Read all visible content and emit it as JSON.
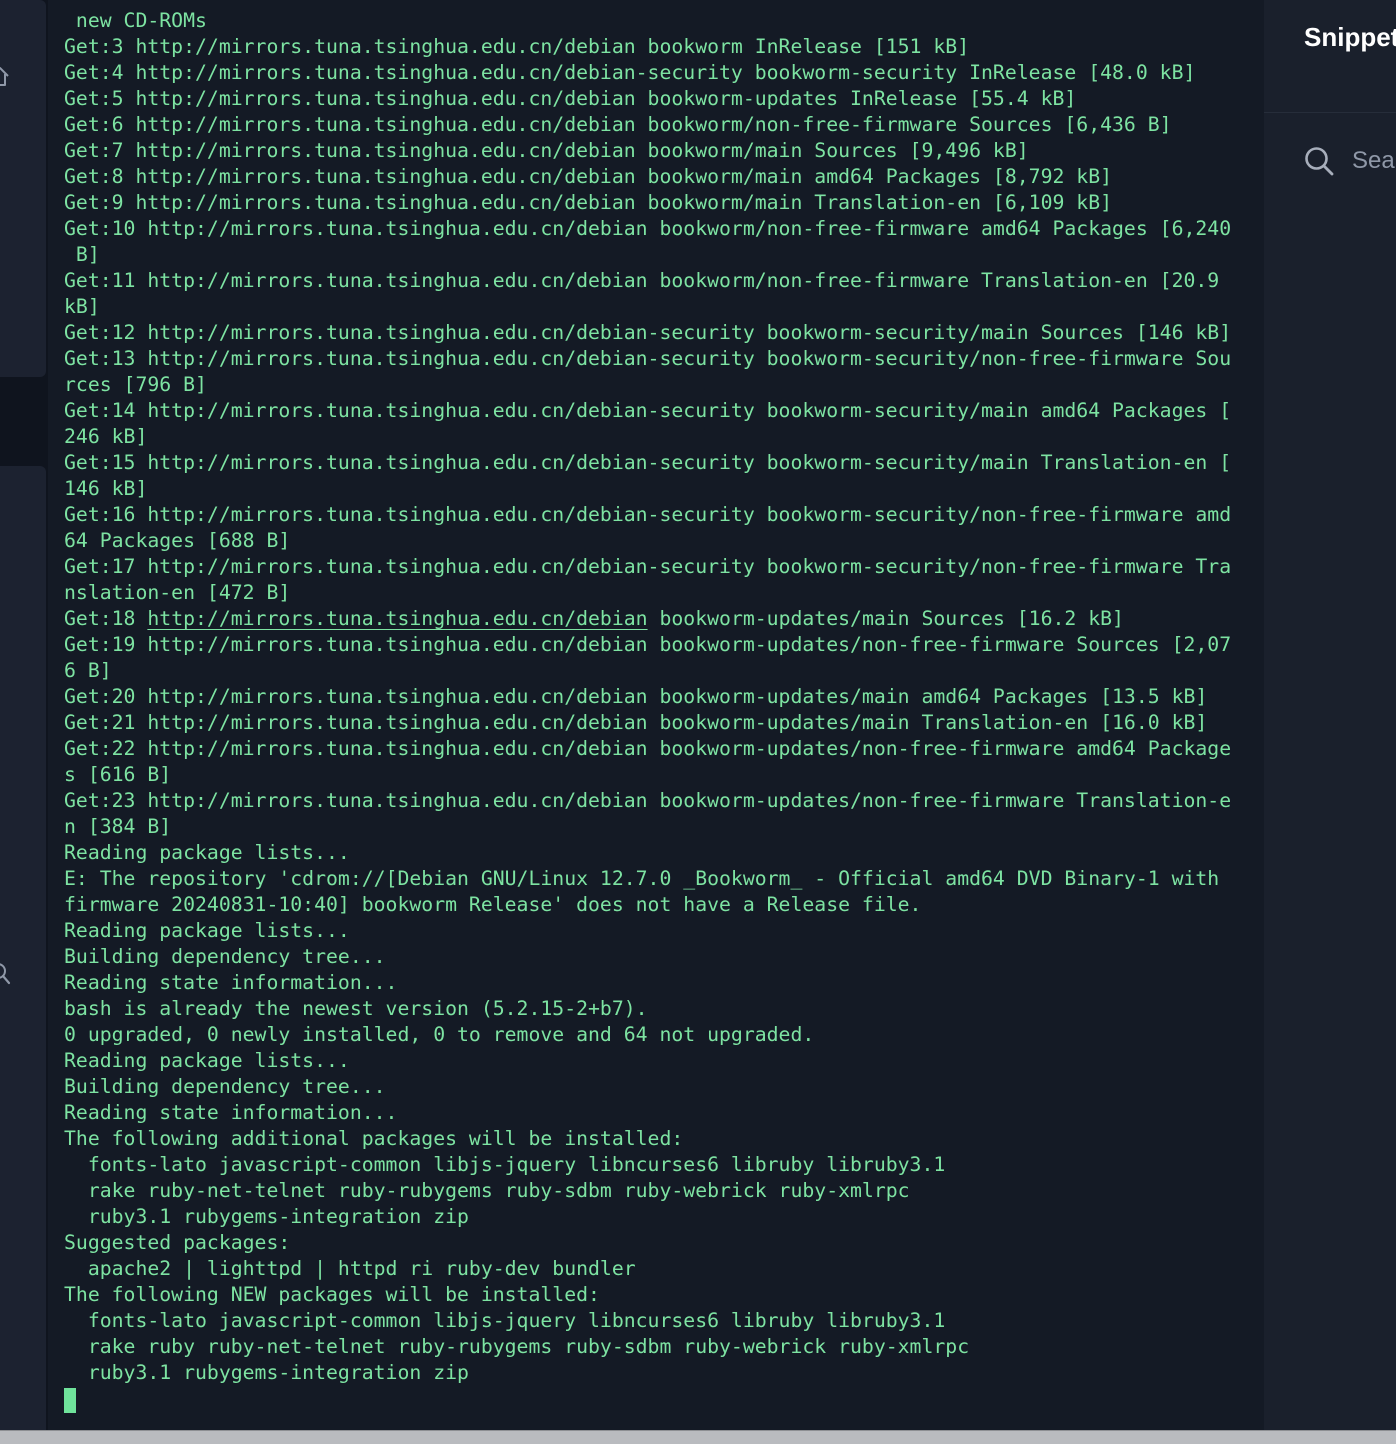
{
  "snippets": {
    "title": "Snippets",
    "search_placeholder": "Search"
  },
  "terminal": {
    "lines": [
      " new CD-ROMs",
      "Get:3 http://mirrors.tuna.tsinghua.edu.cn/debian bookworm InRelease [151 kB]",
      "Get:4 http://mirrors.tuna.tsinghua.edu.cn/debian-security bookworm-security InRelease [48.0 kB]",
      "Get:5 http://mirrors.tuna.tsinghua.edu.cn/debian bookworm-updates InRelease [55.4 kB]",
      "Get:6 http://mirrors.tuna.tsinghua.edu.cn/debian bookworm/non-free-firmware Sources [6,436 B]",
      "Get:7 http://mirrors.tuna.tsinghua.edu.cn/debian bookworm/main Sources [9,496 kB]",
      "Get:8 http://mirrors.tuna.tsinghua.edu.cn/debian bookworm/main amd64 Packages [8,792 kB]",
      "Get:9 http://mirrors.tuna.tsinghua.edu.cn/debian bookworm/main Translation-en [6,109 kB]",
      "Get:10 http://mirrors.tuna.tsinghua.edu.cn/debian bookworm/non-free-firmware amd64 Packages [6,240",
      " B]",
      "Get:11 http://mirrors.tuna.tsinghua.edu.cn/debian bookworm/non-free-firmware Translation-en [20.9",
      "kB]",
      "Get:12 http://mirrors.tuna.tsinghua.edu.cn/debian-security bookworm-security/main Sources [146 kB]",
      "Get:13 http://mirrors.tuna.tsinghua.edu.cn/debian-security bookworm-security/non-free-firmware Sou",
      "rces [796 B]",
      "Get:14 http://mirrors.tuna.tsinghua.edu.cn/debian-security bookworm-security/main amd64 Packages [",
      "246 kB]",
      "Get:15 http://mirrors.tuna.tsinghua.edu.cn/debian-security bookworm-security/main Translation-en [",
      "146 kB]",
      "Get:16 http://mirrors.tuna.tsinghua.edu.cn/debian-security bookworm-security/non-free-firmware amd",
      "64 Packages [688 B]",
      "Get:17 http://mirrors.tuna.tsinghua.edu.cn/debian-security bookworm-security/non-free-firmware Tra",
      "nslation-en [472 B]",
      {
        "prefix": "Get:18 ",
        "link": "http://mirrors.tuna.tsinghua.edu.cn/debian",
        "suffix": " bookworm-updates/main Sources [16.2 kB]"
      },
      "Get:19 http://mirrors.tuna.tsinghua.edu.cn/debian bookworm-updates/non-free-firmware Sources [2,07",
      "6 B]",
      "Get:20 http://mirrors.tuna.tsinghua.edu.cn/debian bookworm-updates/main amd64 Packages [13.5 kB]",
      "Get:21 http://mirrors.tuna.tsinghua.edu.cn/debian bookworm-updates/main Translation-en [16.0 kB]",
      "Get:22 http://mirrors.tuna.tsinghua.edu.cn/debian bookworm-updates/non-free-firmware amd64 Package",
      "s [616 B]",
      "Get:23 http://mirrors.tuna.tsinghua.edu.cn/debian bookworm-updates/non-free-firmware Translation-e",
      "n [384 B]",
      "Reading package lists...",
      "E: The repository 'cdrom://[Debian GNU/Linux 12.7.0 _Bookworm_ - Official amd64 DVD Binary-1 with",
      "firmware 20240831-10:40] bookworm Release' does not have a Release file.",
      "Reading package lists...",
      "Building dependency tree...",
      "Reading state information...",
      "bash is already the newest version (5.2.15-2+b7).",
      "0 upgraded, 0 newly installed, 0 to remove and 64 not upgraded.",
      "Reading package lists...",
      "Building dependency tree...",
      "Reading state information...",
      "The following additional packages will be installed:",
      "  fonts-lato javascript-common libjs-jquery libncurses6 libruby libruby3.1",
      "  rake ruby-net-telnet ruby-rubygems ruby-sdbm ruby-webrick ruby-xmlrpc",
      "  ruby3.1 rubygems-integration zip",
      "Suggested packages:",
      "  apache2 | lighttpd | httpd ri ruby-dev bundler",
      "The following NEW packages will be installed:",
      "  fonts-lato javascript-common libjs-jquery libncurses6 libruby libruby3.1",
      "  rake ruby ruby-net-telnet ruby-rubygems ruby-sdbm ruby-webrick ruby-xmlrpc",
      "  ruby3.1 rubygems-integration zip"
    ]
  },
  "icons": {
    "left_top": "home-icon",
    "left_mid": "search-icon",
    "snippets_search": "search-icon"
  },
  "colors": {
    "terminal_text": "#7de3a2",
    "terminal_bg": "#141a25",
    "cursor": "#6fe39b",
    "panel_bg": "#1a202c",
    "title_text": "#ffffff"
  }
}
